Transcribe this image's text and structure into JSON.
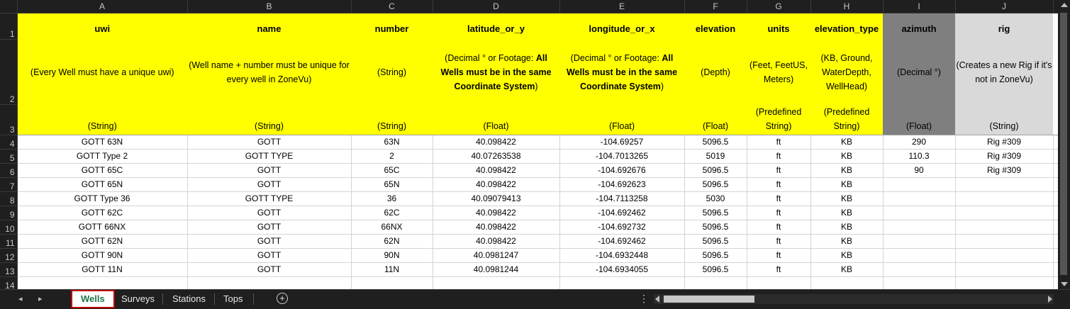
{
  "columns": [
    "A",
    "B",
    "C",
    "D",
    "E",
    "F",
    "G",
    "H",
    "I",
    "J"
  ],
  "header_row1": [
    "uwi",
    "name",
    "number",
    "latitude_or_y",
    "longitude_or_x",
    "elevation",
    "units",
    "elevation_type",
    "azimuth",
    "rig"
  ],
  "header_row2": {
    "A": "(Every Well must have a unique uwi)",
    "B": "(Well name + number must be unique for every well in ZoneVu)",
    "C": "(String)",
    "D_pre": "(Decimal ° or Footage: ",
    "D_bold": "All Wells must be in the same Coordinate System",
    "D_post": ")",
    "E_pre": "(Decimal ° or Footage: ",
    "E_bold": "All Wells must be in the same Coordinate System",
    "E_post": ")",
    "F": "(Depth)",
    "G": "(Feet, FeetUS, Meters)",
    "H": "(KB, Ground, WaterDepth, WellHead)",
    "I": "(Decimal °)",
    "J": "(Creates a new Rig if it's not in ZoneVu)"
  },
  "header_row3": [
    "(String)",
    "(String)",
    "(String)",
    "(Float)",
    "(Float)",
    "(Float)",
    "(Predefined String)",
    "(Predefined String)",
    "(Float)",
    "(String)"
  ],
  "row_numbers": [
    "1",
    "2",
    "3",
    "4",
    "5",
    "6",
    "7",
    "8",
    "9",
    "10",
    "11",
    "12",
    "13",
    "14"
  ],
  "rows": [
    [
      "GOTT 63N",
      "GOTT",
      "63N",
      "40.098422",
      "-104.69257",
      "5096.5",
      "ft",
      "KB",
      "290",
      "Rig #309"
    ],
    [
      "GOTT Type 2",
      "GOTT TYPE",
      "2",
      "40.07263538",
      "-104.7013265",
      "5019",
      "ft",
      "KB",
      "110.3",
      "Rig #309"
    ],
    [
      "GOTT 65C",
      "GOTT",
      "65C",
      "40.098422",
      "-104.692676",
      "5096.5",
      "ft",
      "KB",
      "90",
      "Rig #309"
    ],
    [
      "GOTT 65N",
      "GOTT",
      "65N",
      "40.098422",
      "-104.692623",
      "5096.5",
      "ft",
      "KB",
      "",
      ""
    ],
    [
      "GOTT Type 36",
      "GOTT TYPE",
      "36",
      "40.09079413",
      "-104.7113258",
      "5030",
      "ft",
      "KB",
      "",
      ""
    ],
    [
      "GOTT 62C",
      "GOTT",
      "62C",
      "40.098422",
      "-104.692462",
      "5096.5",
      "ft",
      "KB",
      "",
      ""
    ],
    [
      "GOTT 66NX",
      "GOTT",
      "66NX",
      "40.098422",
      "-104.692732",
      "5096.5",
      "ft",
      "KB",
      "",
      ""
    ],
    [
      "GOTT 62N",
      "GOTT",
      "62N",
      "40.098422",
      "-104.692462",
      "5096.5",
      "ft",
      "KB",
      "",
      ""
    ],
    [
      "GOTT 90N",
      "GOTT",
      "90N",
      "40.0981247",
      "-104.6932448",
      "5096.5",
      "ft",
      "KB",
      "",
      ""
    ],
    [
      "GOTT 11N",
      "GOTT",
      "11N",
      "40.0981244",
      "-104.6934055",
      "5096.5",
      "ft",
      "KB",
      "",
      ""
    ],
    [
      "",
      "",
      "",
      "",
      "",
      "",
      "",
      "",
      "",
      ""
    ]
  ],
  "sheet_tabs": [
    {
      "label": "Wells",
      "active": true
    },
    {
      "label": "Surveys",
      "active": false
    },
    {
      "label": "Stations",
      "active": false
    },
    {
      "label": "Tops",
      "active": false
    }
  ],
  "nav": {
    "prev": "◂",
    "next": "▸",
    "add": "+",
    "more": "⋮"
  },
  "colors": {
    "header_yellow": "#ffff00",
    "azimuth_gray": "#7f7f7f",
    "rig_gray": "#d9d9d9",
    "active_tab_border": "#c00000",
    "active_tab_text": "#217346"
  }
}
